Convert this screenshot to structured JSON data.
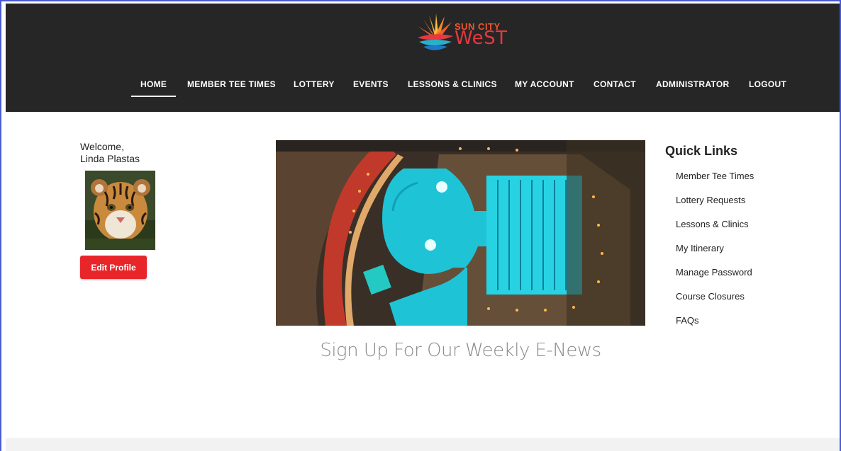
{
  "brand": {
    "line1": "SUN CITY",
    "line2": "WeST",
    "colors": {
      "orange": "#f0542f",
      "red": "#e8373f",
      "blue": "#1f78c8",
      "teal": "#2bb0c9"
    }
  },
  "nav": {
    "items": [
      {
        "label": "HOME",
        "active": true
      },
      {
        "label": "MEMBER TEE TIMES"
      },
      {
        "label": "LOTTERY"
      },
      {
        "label": "EVENTS"
      },
      {
        "label": "LESSONS & CLINICS"
      },
      {
        "label": "MY ACCOUNT"
      },
      {
        "label": "CONTACT"
      },
      {
        "label": "ADMINISTRATOR"
      },
      {
        "label": "LOGOUT"
      }
    ]
  },
  "profile": {
    "welcome": "Welcome,",
    "name": "Linda Plastas",
    "edit_label": "Edit Profile",
    "avatar_icon": "tiger-cub-photo"
  },
  "hero": {
    "image": "aerial-pool-night-photo"
  },
  "enews": {
    "text": "Sign Up For Our Weekly E-News"
  },
  "quick_links": {
    "title": "Quick Links",
    "items": [
      "Member Tee Times",
      "Lottery Requests",
      "Lessons & Clinics",
      "My Itinerary",
      "Manage Password",
      "Course Closures",
      "FAQs"
    ]
  },
  "colors": {
    "header_bg": "#262626",
    "button_red": "#e8262a",
    "frame_border": "#4a5bd4"
  }
}
